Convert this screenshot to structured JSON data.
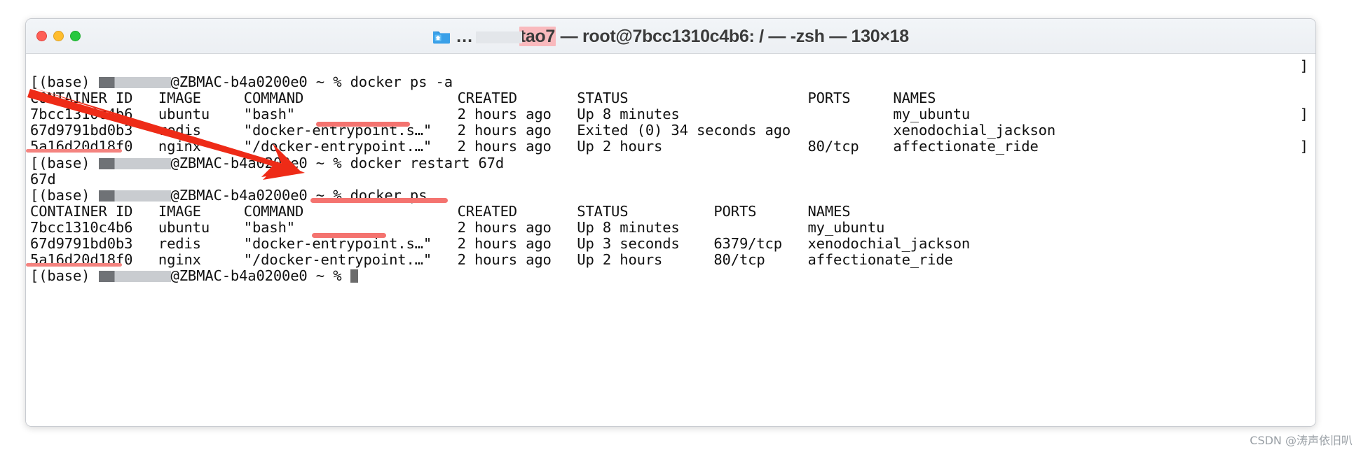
{
  "window": {
    "title_prefix": "…tao7",
    "title_highlight": "tao7",
    "title_rest": " — root@7bcc1310c4b6: / — -zsh — 130×18",
    "full_title": "…tao7 — root@7bcc1310c4b6: / — -zsh — 130×18",
    "folder_icon": "home-folder-icon",
    "traffic_lights": [
      "close-button",
      "minimize-button",
      "maximize-button"
    ],
    "colors": {
      "close": "#ff5f57",
      "minimize": "#ffbd2e",
      "maximize": "#28c840",
      "annotation": "#f4736f",
      "arrow": "#ee2b17",
      "highlight": "#f9b9bd"
    }
  },
  "terminal": {
    "shell": "-zsh",
    "size": "130×18",
    "host": "ZBMAC-b4a0200e0",
    "env": "(base)",
    "cwd": "~",
    "prompt_symbol": "%",
    "lines": [
      {
        "type": "prompt",
        "pre": "[(base) ",
        "user_redacted": true,
        "post": "@ZBMAC-b4a0200e0 ~ % ",
        "command": "docker ps -a"
      },
      {
        "type": "header",
        "text": "CONTAINER ID   IMAGE     COMMAND                  CREATED       STATUS                     PORTS     NAMES"
      },
      {
        "type": "row",
        "text": "7bcc1310c4b6   ubuntu    \"bash\"                   2 hours ago   Up 8 minutes                         my_ubuntu"
      },
      {
        "type": "row",
        "text": "67d9791bd0b3   redis     \"docker-entrypoint.s…\"   2 hours ago   Exited (0) 34 seconds ago            xenodochial_jackson"
      },
      {
        "type": "row",
        "text": "5a16d20d18f0   nginx     \"/docker-entrypoint.…\"   2 hours ago   Up 2 hours                 80/tcp    affectionate_ride"
      },
      {
        "type": "prompt",
        "pre": "[(base) ",
        "user_redacted": true,
        "post": "@ZBMAC-b4a0200e0 ~ % ",
        "command": "docker restart 67d"
      },
      {
        "type": "output",
        "text": "67d"
      },
      {
        "type": "prompt",
        "pre": "[(base) ",
        "user_redacted": true,
        "post": "@ZBMAC-b4a0200e0 ~ % ",
        "command": "docker ps"
      },
      {
        "type": "header",
        "text": "CONTAINER ID   IMAGE     COMMAND                  CREATED       STATUS          PORTS      NAMES"
      },
      {
        "type": "row",
        "text": "7bcc1310c4b6   ubuntu    \"bash\"                   2 hours ago   Up 8 minutes               my_ubuntu"
      },
      {
        "type": "row",
        "text": "67d9791bd0b3   redis     \"docker-entrypoint.s…\"   2 hours ago   Up 3 seconds    6379/tcp   xenodochial_jackson"
      },
      {
        "type": "row",
        "text": "5a16d20d18f0   nginx     \"/docker-entrypoint.…\"   2 hours ago   Up 2 hours      80/tcp     affectionate_ride"
      },
      {
        "type": "prompt_final",
        "pre": "[(base) ",
        "user_redacted": true,
        "post": "@ZBMAC-b4a0200e0 ~ % ",
        "command": ""
      }
    ],
    "right_markers": [
      "]",
      "]",
      "]"
    ],
    "columns_first_table": [
      "CONTAINER ID",
      "IMAGE",
      "COMMAND",
      "CREATED",
      "STATUS",
      "PORTS",
      "NAMES"
    ],
    "columns_second_table": [
      "CONTAINER ID",
      "IMAGE",
      "COMMAND",
      "CREATED",
      "STATUS",
      "PORTS",
      "NAMES"
    ],
    "containers_before": [
      {
        "id": "7bcc1310c4b6",
        "image": "ubuntu",
        "command": "\"bash\"",
        "created": "2 hours ago",
        "status": "Up 8 minutes",
        "ports": "",
        "name": "my_ubuntu"
      },
      {
        "id": "67d9791bd0b3",
        "image": "redis",
        "command": "\"docker-entrypoint.s…\"",
        "created": "2 hours ago",
        "status": "Exited (0) 34 seconds ago",
        "ports": "",
        "name": "xenodochial_jackson"
      },
      {
        "id": "5a16d20d18f0",
        "image": "nginx",
        "command": "\"/docker-entrypoint.…\"",
        "created": "2 hours ago",
        "status": "Up 2 hours",
        "ports": "80/tcp",
        "name": "affectionate_ride"
      }
    ],
    "containers_after": [
      {
        "id": "7bcc1310c4b6",
        "image": "ubuntu",
        "command": "\"bash\"",
        "created": "2 hours ago",
        "status": "Up 8 minutes",
        "ports": "",
        "name": "my_ubuntu"
      },
      {
        "id": "67d9791bd0b3",
        "image": "redis",
        "command": "\"docker-entrypoint.s…\"",
        "created": "2 hours ago",
        "status": "Up 3 seconds",
        "ports": "6379/tcp",
        "name": "xenodochial_jackson"
      },
      {
        "id": "5a16d20d18f0",
        "image": "nginx",
        "command": "\"/docker-entrypoint.…\"",
        "created": "2 hours ago",
        "status": "Up 2 hours",
        "ports": "80/tcp",
        "name": "affectionate_ride"
      }
    ],
    "restart_output": "67d"
  },
  "annotations": {
    "underline_command_1": "docker ps -a command area",
    "underline_command_2": "docker restart 67d",
    "underline_command_3": "docker ps command area",
    "underline_id_1": "67d9791bd0b3",
    "underline_id_2": "67d9791bd0b3",
    "arrow_label": "red-arrow-pointing-to-restart-command"
  },
  "watermark": {
    "text": "CSDN @涛声依旧叭"
  }
}
